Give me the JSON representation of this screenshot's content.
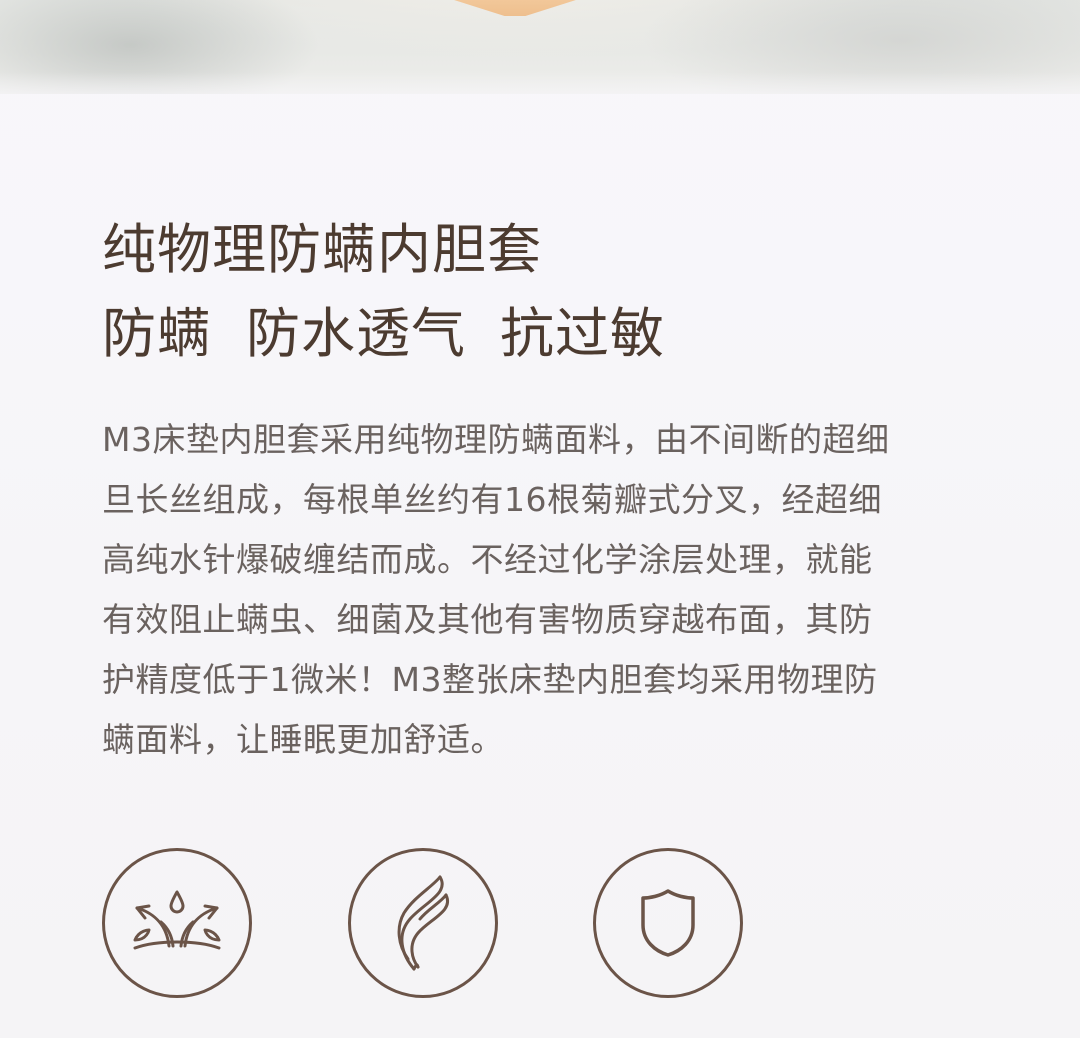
{
  "headline": {
    "line1": "纯物理防螨内胆套",
    "line2_parts": [
      "防螨",
      "防水透气",
      "抗过敏"
    ]
  },
  "description": {
    "lines": [
      "M3床垫内胆套采用纯物理防螨面料，由不间断的超细",
      "旦长丝组成，每根单丝约有16根菊瓣式分叉，经超细",
      "高纯水针爆破缠结而成。不经过化学涂层处理，就能",
      "有效阻止螨虫、细菌及其他有害物质穿越布面，其防",
      "护精度低于1微米！M3整张床垫内胆套均采用物理防",
      "螨面料，让睡眠更加舒适。"
    ]
  },
  "features": [
    {
      "icon": "breathable-droplet-arrows-icon"
    },
    {
      "icon": "wave-fabric-icon"
    },
    {
      "icon": "shield-icon"
    }
  ],
  "colors": {
    "title": "#4c3b30",
    "body_text": "#6a625f",
    "icon_stroke": "#6b5448",
    "background": "#f7f6f9",
    "accent_mattress": "#f0c392"
  }
}
